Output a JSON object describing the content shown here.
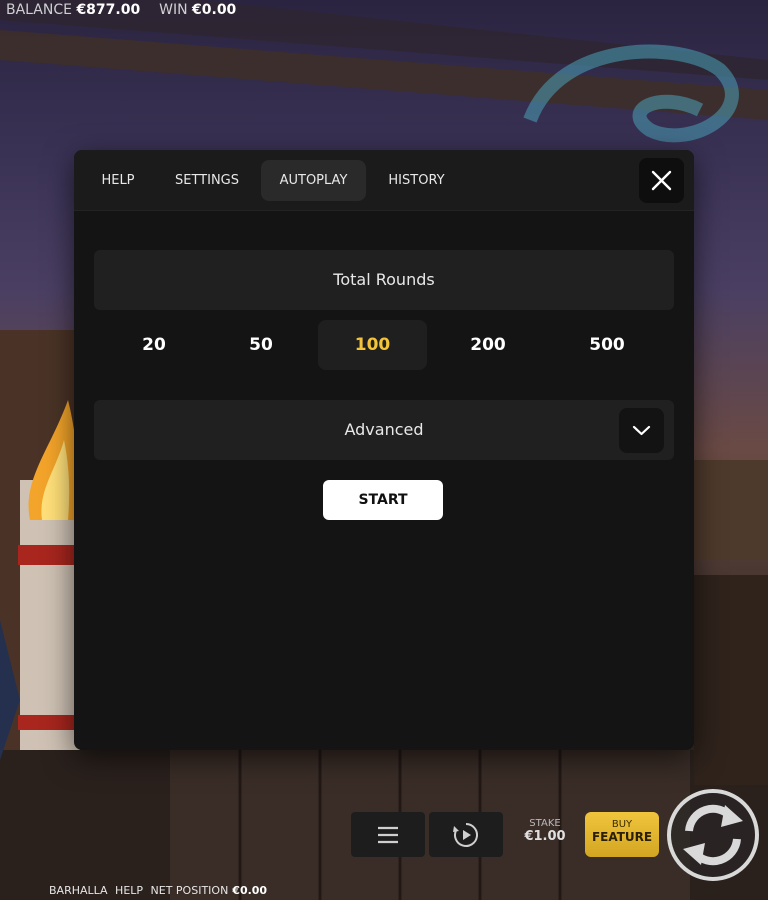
{
  "topbar": {
    "balance_label": "BALANCE",
    "balance_value": "€877.00",
    "win_label": "WIN",
    "win_value": "€0.00"
  },
  "modal": {
    "tabs": [
      {
        "label": "HELP",
        "active": false
      },
      {
        "label": "SETTINGS",
        "active": false
      },
      {
        "label": "AUTOPLAY",
        "active": true
      },
      {
        "label": "HISTORY",
        "active": false
      }
    ],
    "close_icon": "close-icon",
    "total_rounds_label": "Total Rounds",
    "rounds": [
      {
        "label": "20",
        "selected": false
      },
      {
        "label": "50",
        "selected": false
      },
      {
        "label": "100",
        "selected": true
      },
      {
        "label": "200",
        "selected": false
      },
      {
        "label": "500",
        "selected": false
      }
    ],
    "advanced_label": "Advanced",
    "advanced_icon": "chevron-down-icon",
    "start_label": "START",
    "selected_color": "#f3c33a"
  },
  "controls": {
    "menu_icon": "hamburger-menu-icon",
    "autoplay_icon": "autoplay-icon",
    "stake_label": "STAKE",
    "stake_value": "€1.00",
    "buy_line1": "BUY",
    "buy_line2": "FEATURE",
    "buy_color": "#e4b832",
    "spin_icon": "spin-icon"
  },
  "footer": {
    "game_name": "BARHALLA",
    "help_label": "HELP",
    "net_position_label": "NET POSITION",
    "net_position_value": "€0.00"
  }
}
